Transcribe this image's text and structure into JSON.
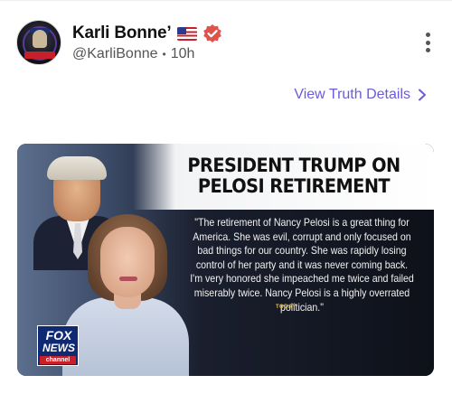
{
  "post": {
    "author_name": "Karli Bonne’",
    "flag_icon": "us-flag-icon",
    "verified_icon": "verified-badge-icon",
    "handle": "@KarliBonne",
    "separator": "•",
    "time_ago": "10h",
    "more_icon": "more-vertical-icon"
  },
  "link": {
    "view_details_label": "View Truth Details",
    "chevron_icon": "chevron-right-icon"
  },
  "media": {
    "headline": "PRESIDENT TRUMP ON PELOSI RETIREMENT",
    "quote": "\"The retirement of Nancy Pelosi is a great thing for America. She was evil, corrupt and only focused on bad things for our country. She was rapidly losing control of her party and it was never coming back. I'm very honored she impeached me twice and failed miserably twice. Nancy Pelosi is a highly overrated politician.\"",
    "dateline": "TODAY",
    "logo": {
      "line1": "FOX",
      "line2": "NEWS",
      "line3": "channel"
    }
  },
  "colors": {
    "accent_link": "#6a5bd8",
    "verified_bg": "#e0534a",
    "fox_blue": "#0f2a73",
    "fox_red": "#c8202b"
  }
}
